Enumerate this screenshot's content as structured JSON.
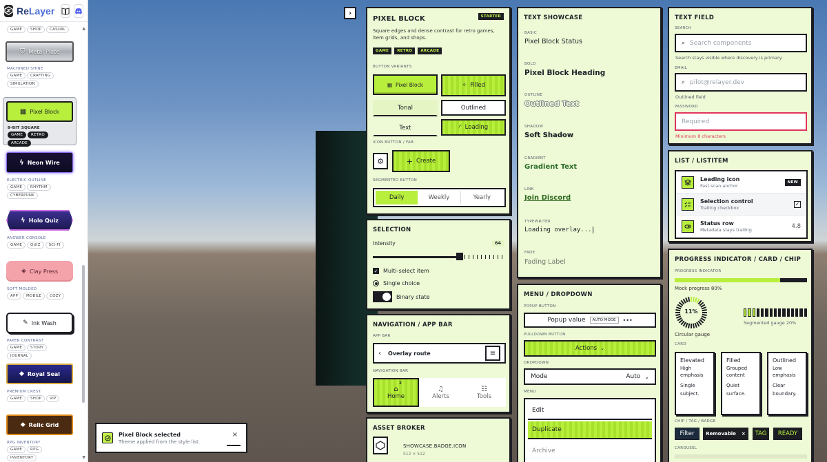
{
  "app": {
    "name_a": "Re",
    "name_b": "Layer"
  },
  "sidebar": {
    "top_tags": [
      "GAME",
      "SHOP",
      "CASUAL"
    ],
    "skins": [
      {
        "label": "Metal Plate",
        "category": "MACHINED SHINE",
        "tags": [
          "GAME",
          "CRAFTING",
          "SIMULATION"
        ],
        "icon": "shield-icon"
      },
      {
        "label": "Pixel Block",
        "category": "8-BIT SQUARE",
        "tags": [
          "GAME",
          "RETRO",
          "ARCADE"
        ],
        "icon": "grid-icon",
        "selected": true
      },
      {
        "label": "Neon Wire",
        "category": "ELECTRIC OUTLINE",
        "tags": [
          "GAME",
          "RHYTHM",
          "CYBERPUNK"
        ],
        "icon": "bolt-icon"
      },
      {
        "label": "Holo Quiz",
        "category": "ANSWER CONSOLE",
        "tags": [
          "GAME",
          "QUIZ",
          "SCI-FI"
        ],
        "icon": "bolt-icon"
      },
      {
        "label": "Clay Press",
        "category": "SOFT MOLDED",
        "tags": [
          "APP",
          "MOBILE",
          "COZY"
        ],
        "icon": "cube-icon"
      },
      {
        "label": "Ink Wash",
        "category": "PAPER CONTRAST",
        "tags": [
          "GAME",
          "STORY",
          "JOURNAL"
        ],
        "icon": "wand-icon"
      },
      {
        "label": "Royal Seal",
        "category": "PREMIUM CREST",
        "tags": [
          "GAME",
          "SHOP",
          "VIP"
        ],
        "icon": "gem-icon"
      },
      {
        "label": "Relic Grid",
        "category": "RPG INVENTORY",
        "tags": [
          "GAME",
          "RPG",
          "INVENTORY"
        ],
        "icon": "gem-icon"
      }
    ]
  },
  "toast": {
    "title": "Pixel Block selected",
    "subtitle": "Theme applied from the style list.",
    "close": "×"
  },
  "pixel_block": {
    "title": "PIXEL BLOCK",
    "badge": "STARTER",
    "description": "Square edges and dense contrast for retro games, item grids, and shops.",
    "tags": [
      "GAME",
      "RETRO",
      "ARCADE"
    ],
    "button_variants_label": "BUTTON VARIANTS",
    "buttons": {
      "block": "Pixel Block",
      "filled": "Filled",
      "tonal": "Tonal",
      "outlined": "Outlined",
      "text": "Text",
      "loading": "Loading"
    },
    "icon_button_label": "ICON BUTTON / FAB",
    "fab_label": "Create",
    "segmented_label": "SEGMENTED BUTTON",
    "segments": [
      "Daily",
      "Weekly",
      "Yearly"
    ],
    "selected_segment": 0
  },
  "selection": {
    "title": "SELECTION",
    "intensity_label": "Intensity",
    "intensity_value": "64",
    "slider_fraction": 0.64,
    "multi_select": "Multi-select item",
    "single_choice": "Single choice",
    "binary_state": "Binary state"
  },
  "navigation": {
    "title": "NAVIGATION / APP BAR",
    "app_bar_label": "APP BAR",
    "route": "Overlay route",
    "nav_bar_label": "NAVIGATION BAR",
    "items": [
      {
        "label": "Home",
        "badge": "2"
      },
      {
        "label": "Alerts"
      },
      {
        "label": "Tools"
      }
    ]
  },
  "asset_broker": {
    "title": "ASSET BROKER",
    "asset_name": "SHOWCASE.BADGE.ICON",
    "asset_size": "512 × 512"
  },
  "text_showcase": {
    "title": "TEXT SHOWCASE",
    "items": [
      {
        "label": "BASIC",
        "text": "Pixel Block Status"
      },
      {
        "label": "BOLD",
        "text": "Pixel Block Heading"
      },
      {
        "label": "OUTLINE",
        "text": "Outlined Text"
      },
      {
        "label": "SHADOW",
        "text": "Soft Shadow"
      },
      {
        "label": "GRADIENT",
        "text": "Gradient Text"
      },
      {
        "label": "LINK",
        "text": "Join Discord"
      },
      {
        "label": "TYPEWRITER",
        "text": "Loading overlay..."
      },
      {
        "label": "FADE",
        "text": "Fading Label"
      }
    ]
  },
  "menu": {
    "title": "MENU / DROPDOWN",
    "popup_label": "POPUP BUTTON",
    "popup_value": "Popup value",
    "popup_mode": "AUTO MODE",
    "pulldown_label": "PULLDOWN BUTTON",
    "pulldown_value": "Actions",
    "dropdown_label": "DROPDOWN",
    "dropdown_name": "Mode",
    "dropdown_value": "Auto",
    "menu_label": "MENU",
    "menu_items": [
      "Edit",
      "Duplicate",
      "Archive"
    ],
    "selected_menu_item": 1
  },
  "text_field": {
    "title": "TEXT FIELD",
    "search_label": "SEARCH",
    "search_placeholder": "Search components",
    "search_hint": "Search stays visible where discovery is primary.",
    "email_label": "EMAIL",
    "email_placeholder": "pilot@relayer.dev",
    "email_hint": "Outlined field",
    "password_label": "PASSWORD",
    "password_placeholder": "Required",
    "password_error": "Minimum 8 characters"
  },
  "list": {
    "title": "LIST / LISTITEM",
    "items": [
      {
        "title": "Leading icon",
        "subtitle": "Fast scan anchor",
        "trailing": "NEW"
      },
      {
        "title": "Selection control",
        "subtitle": "Trailing checkbox",
        "trailing": "✓"
      },
      {
        "title": "Status row",
        "subtitle": "Metadata stays trailing",
        "trailing": "4.8"
      }
    ]
  },
  "progress": {
    "title": "PROGRESS INDICATOR / CARD / CHIP",
    "indicator_label": "PROGRESS INDICATOR",
    "mock_label": "Mock progress 80%",
    "mock_fraction": 0.8,
    "circular_value": "11%",
    "circular_fraction": 0.11,
    "circular_label": "Circular gauge",
    "segmented_label": "Segmented gauge 20%",
    "segmented_fraction": 0.2,
    "card_label": "CARD",
    "cards": [
      {
        "title": "Elevated",
        "line1": "High",
        "line2": "emphasis",
        "line3": "Single",
        "line4": "subject."
      },
      {
        "title": "Filled",
        "line1": "Grouped",
        "line2": "content",
        "line3": "Quiet",
        "line4": "surface."
      },
      {
        "title": "Outlined",
        "line1": "Low",
        "line2": "emphasis",
        "line3": "Clear",
        "line4": "boundary."
      }
    ],
    "chip_label": "CHIP / TAG / BADGE",
    "chips": {
      "filter": "Filter",
      "removable": "Removable",
      "tag": "TAG",
      "ready": "READY"
    },
    "carousel_label": "CAROUSEL"
  },
  "colors": {
    "accent": "#b8ee3c",
    "ink": "#1b1d22",
    "panel": "#eef9d5",
    "error": "#e0345c",
    "link": "#2e6b1f"
  }
}
